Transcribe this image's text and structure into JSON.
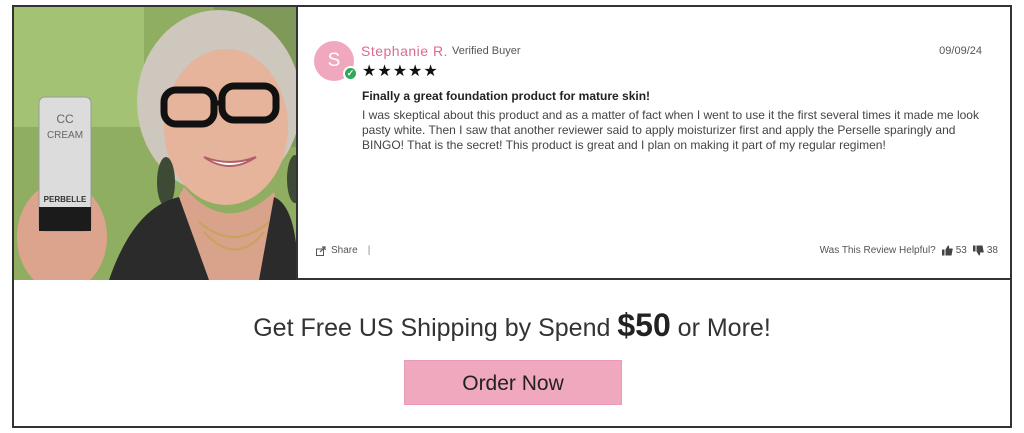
{
  "review": {
    "avatar_initial": "S",
    "reviewer_name": "Stephanie R.",
    "verified_label": "Verified Buyer",
    "date": "09/09/24",
    "rating": 5,
    "stars_text": "★★★★★",
    "title": "Finally a great foundation product for mature skin!",
    "body": "I was skeptical about this product and as a matter of fact when I went to use it the first several times it made me look pasty white. Then I saw that another reviewer said to apply moisturizer first and apply the Perselle sparingly and BINGO! That is the secret! This product is great and I plan on making it part of my regular regimen!",
    "share_label": "Share",
    "share_separator": "|",
    "helpful_question": "Was This Review Helpful?",
    "thumbs_up_count": "53",
    "thumbs_down_count": "38"
  },
  "photo": {
    "product_label_top": "CC",
    "product_label_main": "CREAM",
    "product_brand": "PERBELLE"
  },
  "promo": {
    "text_before": "Get Free US Shipping by Spend ",
    "price": "$50",
    "text_after": " or More!",
    "button_label": "Order Now"
  },
  "colors": {
    "accent_pink": "#f0a8bf",
    "name_pink": "#d86b93",
    "verified_green": "#2fa85a"
  }
}
